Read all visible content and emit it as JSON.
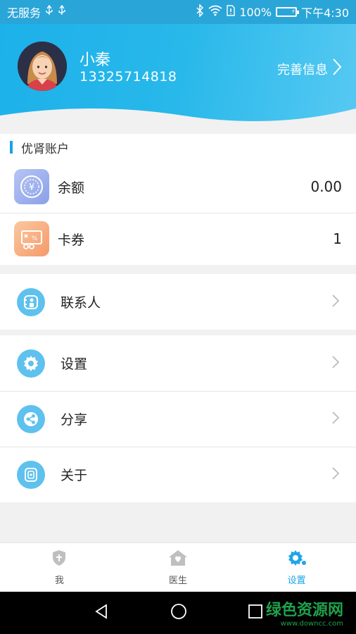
{
  "status_bar": {
    "carrier": "无服务",
    "battery_pct": "100%",
    "time": "下午4:30",
    "battery_level": 1.0
  },
  "profile": {
    "name": "小秦",
    "phone": "13325714818",
    "complete_info_label": "完善信息"
  },
  "account": {
    "section_title": "优肾账户",
    "items": [
      {
        "label": "余额",
        "value": "0.00",
        "icon": "balance-icon"
      },
      {
        "label": "卡券",
        "value": "1",
        "icon": "coupon-icon"
      }
    ]
  },
  "menu": {
    "contacts_label": "联系人",
    "settings_label": "设置",
    "share_label": "分享",
    "about_label": "关于"
  },
  "tabs": [
    {
      "label": "我",
      "icon": "shield-icon",
      "active": false
    },
    {
      "label": "医生",
      "icon": "house-icon",
      "active": false
    },
    {
      "label": "设置",
      "icon": "gear-icon",
      "active": true
    }
  ],
  "watermark": {
    "title": "绿色资源网",
    "url": "www.downcc.com"
  },
  "colors": {
    "accent": "#1da6e8",
    "menu_icon_bg": "#5ec1ee"
  }
}
